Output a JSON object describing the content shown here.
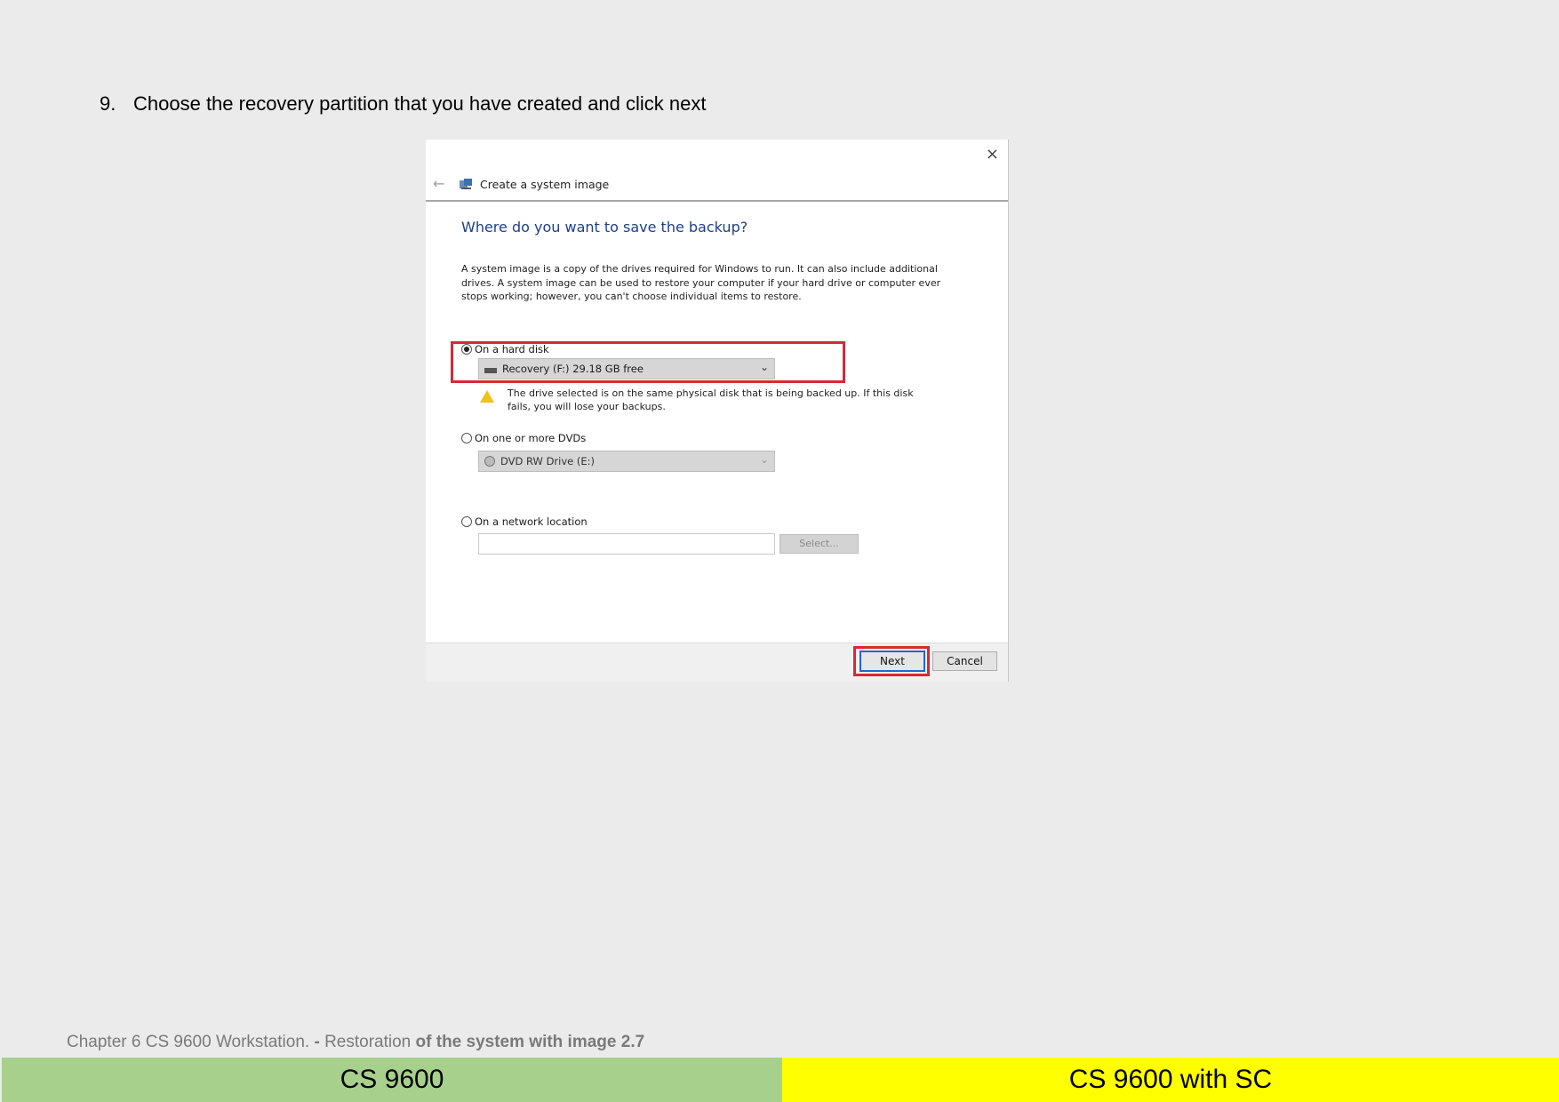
{
  "step": {
    "number": "9.",
    "text": "Choose the recovery partition that you have created and click next"
  },
  "dialog": {
    "close_glyph": "×",
    "back_glyph": "←",
    "title": "Create a system image",
    "heading": "Where do you want to save the backup?",
    "description": "A system image is a copy of the drives required for Windows to run. It can also include additional drives. A system image can be used to restore your computer if your hard drive or computer ever stops working; however, you can't choose individual items to restore.",
    "options": {
      "hard_disk": {
        "label": "On a hard disk",
        "selected": true,
        "drive_value": "Recovery (F:)  29.18 GB free",
        "warning": "The drive selected is on the same physical disk that is being backed up. If this disk fails, you will lose your backups."
      },
      "dvds": {
        "label": "On one or more DVDs",
        "selected": false,
        "drive_value": "DVD RW Drive (E:)"
      },
      "network": {
        "label": "On a network location",
        "selected": false,
        "input_value": "",
        "select_button": "Select..."
      }
    },
    "buttons": {
      "next": "Next",
      "cancel": "Cancel"
    },
    "icons": {
      "app": "system-image-icon",
      "warning": "warning-icon",
      "drive": "hard-drive-icon",
      "dvd": "dvd-drive-icon",
      "dropdown": "chevron-down-icon"
    },
    "highlight_color": "#d42a36"
  },
  "footer": {
    "chapter_plain_1": "Chapter 6 CS 9600 Workstation.",
    "chapter_bold_1": " - ",
    "chapter_plain_2": "Restoration",
    "chapter_bold_2": " of the system with image 2.7"
  },
  "bands": {
    "left": "CS 9600",
    "right": "CS 9600 with SC",
    "left_color": "#a8d08d",
    "right_color": "#ffff00"
  }
}
